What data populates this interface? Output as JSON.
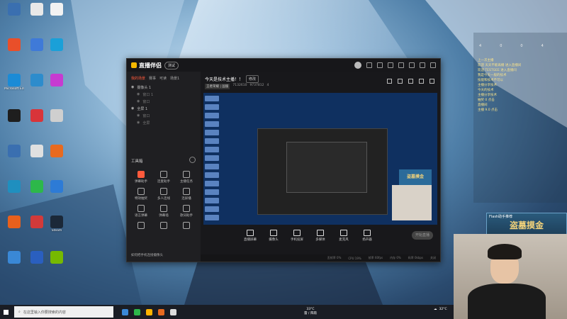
{
  "desktop": {
    "icons": [
      {
        "label": "",
        "color": "#3a6fb0"
      },
      {
        "label": "",
        "color": "#e8e8e8"
      },
      {
        "label": "",
        "color": "#f2f2f2"
      },
      {
        "label": "",
        "color": "#e94f2a"
      },
      {
        "label": "",
        "color": "#3f7ad8"
      },
      {
        "label": "",
        "color": "#1aa0d8"
      },
      {
        "label": "Microsoft Edge",
        "color": "#1b8bd6"
      },
      {
        "label": "",
        "color": "#2d8ccc"
      },
      {
        "label": "",
        "color": "#c73bd1"
      },
      {
        "label": "",
        "color": "#1e1e1e"
      },
      {
        "label": "",
        "color": "#d8343a"
      },
      {
        "label": "",
        "color": "#cfcfcf"
      },
      {
        "label": "",
        "color": "#3a6fb0"
      },
      {
        "label": "",
        "color": "#e0e0e0"
      },
      {
        "label": "",
        "color": "#e86a1f"
      },
      {
        "label": "",
        "color": "#1f8fbf"
      },
      {
        "label": "",
        "color": "#2db84a"
      },
      {
        "label": "",
        "color": "#2d7bd6"
      },
      {
        "label": "",
        "color": "#e8601c"
      },
      {
        "label": "",
        "color": "#d23a3a"
      },
      {
        "label": "Steam",
        "color": "#1b2838"
      },
      {
        "label": "",
        "color": "#3a88d6"
      },
      {
        "label": "",
        "color": "#2a5fbf"
      },
      {
        "label": "",
        "color": "#76b900"
      }
    ]
  },
  "app": {
    "logo_text": "直播伴侣",
    "badge_label": "测试",
    "tabs": [
      "我的场景",
      "赛事",
      "可读",
      "场景1"
    ],
    "scenes": [
      {
        "label": "摄像头 1",
        "sub": false
      },
      {
        "label": "窗口 1",
        "sub": true
      },
      {
        "label": "窗口",
        "sub": true
      },
      {
        "label": "全屏 1",
        "sub": false
      },
      {
        "label": "窗口",
        "sub": true
      },
      {
        "label": "全屏",
        "sub": true
      }
    ],
    "tools_title": "工具箱",
    "tools": [
      {
        "label": "弹幕助手",
        "red": true
      },
      {
        "label": "连麦助手",
        "red": false
      },
      {
        "label": "主播任务",
        "red": false
      },
      {
        "label": "特效抽奖",
        "red": false
      },
      {
        "label": "多人连线",
        "red": false
      },
      {
        "label": "连屏播",
        "red": false
      },
      {
        "label": "语言弹幕",
        "red": false
      },
      {
        "label": "弹幕墙",
        "red": false
      },
      {
        "label": "歌词助手",
        "red": false
      },
      {
        "label": "",
        "red": false
      },
      {
        "label": "",
        "red": false
      },
      {
        "label": "",
        "red": false
      }
    ],
    "bottom_tip": "如何把手机连接摄像头",
    "stream_title": "今天是技术主播！！",
    "edit_label": "修改",
    "meta": [
      "王者荣耀 | 国服",
      "7132610",
      "9737812",
      "4"
    ],
    "actions": [
      "直播屏幕",
      "摄像头",
      "手机投屏",
      "多媒体",
      "麦克风",
      "扬声器"
    ],
    "start_label": "开始直播",
    "status": [
      "丢帧率 0%",
      "CPU 19%",
      "帧率 60fps",
      "内存 0%",
      "码率 0kbps",
      "关闭"
    ],
    "preview_gift_text": "盗墓摸金"
  },
  "overlay": {
    "top_counts": [
      "4",
      "0",
      "0",
      "4"
    ],
    "chat_lines": [
      "上一次主播",
      "欢迎 天天不能再播 进入直播间",
      "欢迎 TESTGEE 进入直播间",
      "",
      "我是今天一般的技术",
      "技能和技术不可以",
      "主播分享技术",
      "今天的技术",
      "主播分享技术",
      "",
      "抽奖 0 点击",
      "",
      "直播间",
      "主播 9.0 点击"
    ],
    "game_head": "Flash助手推荐",
    "game_title": "盗墓摸金"
  },
  "taskbar": {
    "search_placeholder": "在这里输入你要搜索的内容",
    "weather_temp": "33°C",
    "weather_desc": "雷 / 阵雨",
    "tray_temp": "32°C",
    "icon_colors": [
      "#3a88d6",
      "#2db84a",
      "#ffb400",
      "#e86a1f",
      "#dddddd"
    ]
  }
}
